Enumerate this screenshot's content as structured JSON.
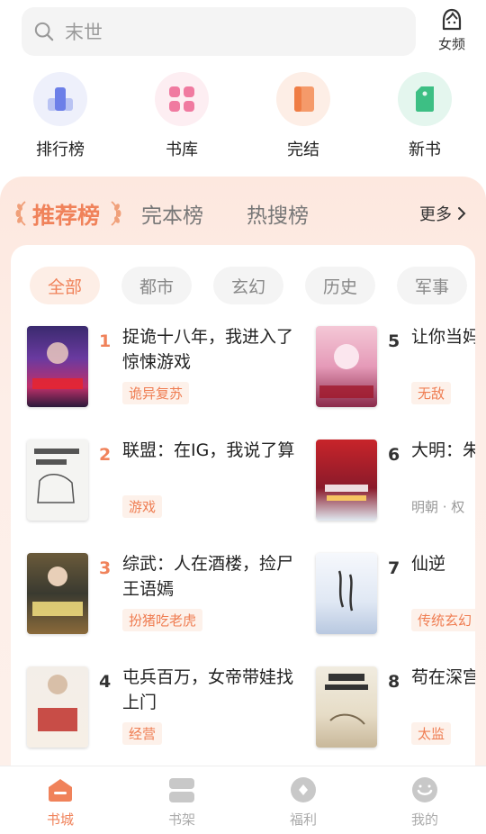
{
  "search": {
    "placeholder": "末世"
  },
  "gender_toggle": {
    "label": "女频"
  },
  "quick_nav": [
    {
      "label": "排行榜",
      "icon": "ranking-icon"
    },
    {
      "label": "书库",
      "icon": "library-icon"
    },
    {
      "label": "完结",
      "icon": "finished-book-icon"
    },
    {
      "label": "新书",
      "icon": "new-book-tag-icon"
    }
  ],
  "rank_tabs": [
    {
      "label": "推荐榜",
      "active": true
    },
    {
      "label": "完本榜",
      "active": false
    },
    {
      "label": "热搜榜",
      "active": false
    }
  ],
  "more_label": "更多",
  "categories": [
    {
      "label": "全部",
      "active": true
    },
    {
      "label": "都市",
      "active": false
    },
    {
      "label": "玄幻",
      "active": false
    },
    {
      "label": "历史",
      "active": false
    },
    {
      "label": "军事",
      "active": false
    }
  ],
  "books": [
    {
      "rank": "1",
      "title": "捉诡十八年，我进入了惊悚游戏",
      "tag": "诡异复苏"
    },
    {
      "rank": "2",
      "title": "联盟：在IG，我说了算",
      "tag": "游戏"
    },
    {
      "rank": "3",
      "title": "综武：人在酒楼，捡尸王语嫣",
      "tag": "扮猪吃老虎"
    },
    {
      "rank": "4",
      "title": "屯兵百万，女帝带娃找上门",
      "tag": "经营"
    },
    {
      "rank": "5",
      "title": "让你当妈，养一群",
      "tag": "无敌"
    },
    {
      "rank": "6",
      "title": "大明：朱元璋",
      "tag": "明朝 · 权"
    },
    {
      "rank": "7",
      "title": "仙逆",
      "tag": "传统玄幻"
    },
    {
      "rank": "8",
      "title": "苟在深宫",
      "tag": "太监"
    }
  ],
  "bottom_nav": [
    {
      "label": "书城",
      "active": true
    },
    {
      "label": "书架",
      "active": false
    },
    {
      "label": "福利",
      "active": false
    },
    {
      "label": "我的",
      "active": false
    }
  ],
  "colors": {
    "accent": "#f0825a",
    "rank_top": "#f0825a",
    "rank_other": "#333333"
  }
}
